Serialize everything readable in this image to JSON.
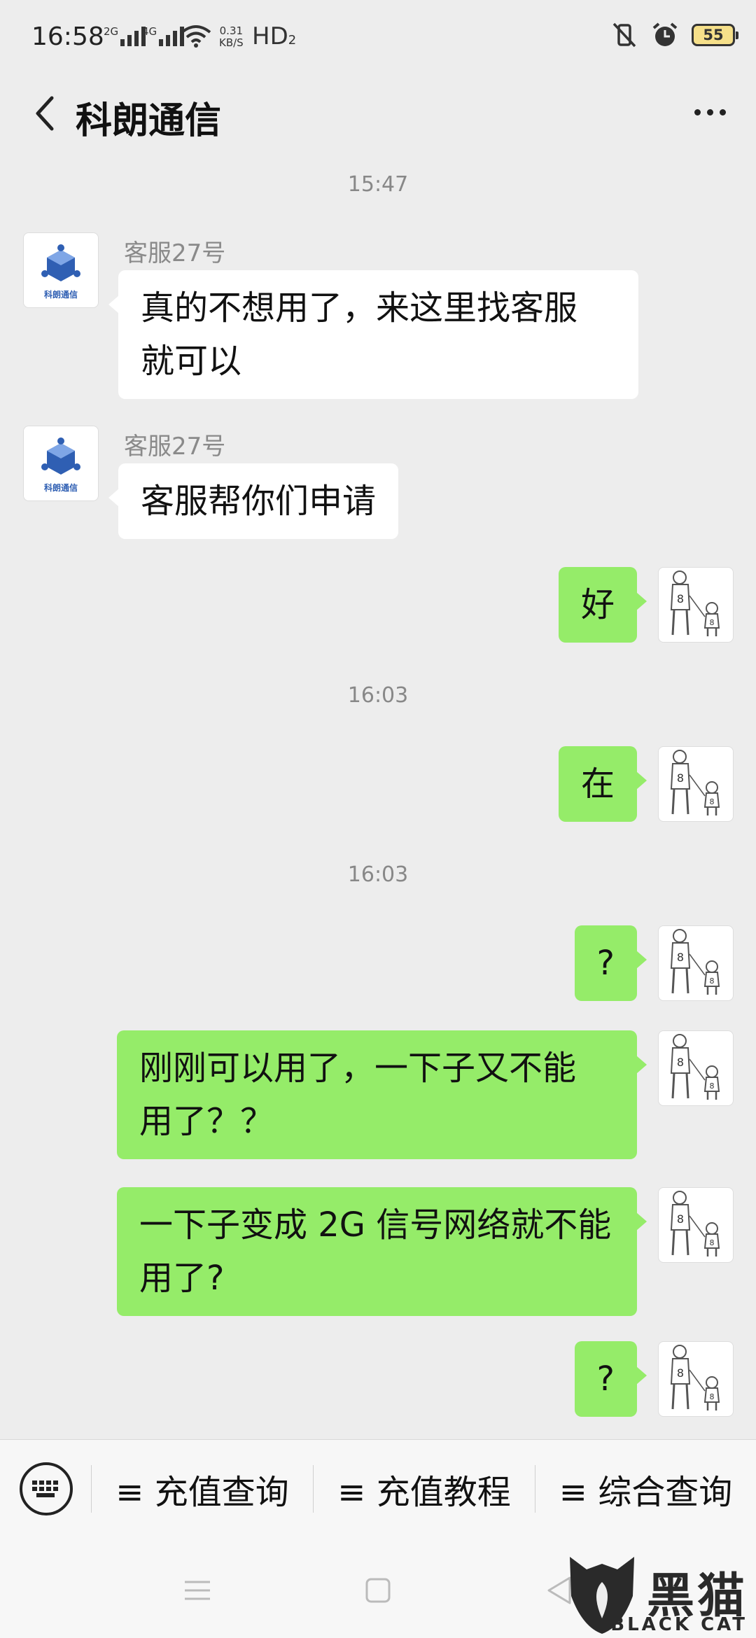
{
  "status_bar": {
    "time": "16:58",
    "net1": "2G",
    "net2": "4G",
    "speed_value": "0.31",
    "speed_unit": "KB/S",
    "hd": "HD",
    "hd_sub": "2",
    "battery": "55"
  },
  "header": {
    "title": "科朗通信"
  },
  "messages": [
    {
      "time": "15:47"
    },
    {
      "sender": "客服27号",
      "text_line1": "真的不想用了，来这里找客服",
      "text_line2": "就可以"
    },
    {
      "sender": "客服27号",
      "text": "客服帮你们申请"
    },
    {
      "text": "好"
    },
    {
      "time": "16:03"
    },
    {
      "text": "在"
    },
    {
      "time": "16:03"
    },
    {
      "text": "?"
    },
    {
      "text_line1": "刚刚可以用了，一下子又不能",
      "text_line2": "用了？？"
    },
    {
      "text_line1": "一下子变成 2G 信号网络就不能",
      "text_line2": "用了?"
    },
    {
      "text": "?"
    }
  ],
  "avatar_logo_text": "科朗通信",
  "bottom_menu": {
    "items": [
      "≡ 充值查询",
      "≡ 充值教程",
      "≡ 综合查询"
    ]
  },
  "watermark": {
    "text": "黑猫",
    "sub": "BLACK CAT"
  }
}
